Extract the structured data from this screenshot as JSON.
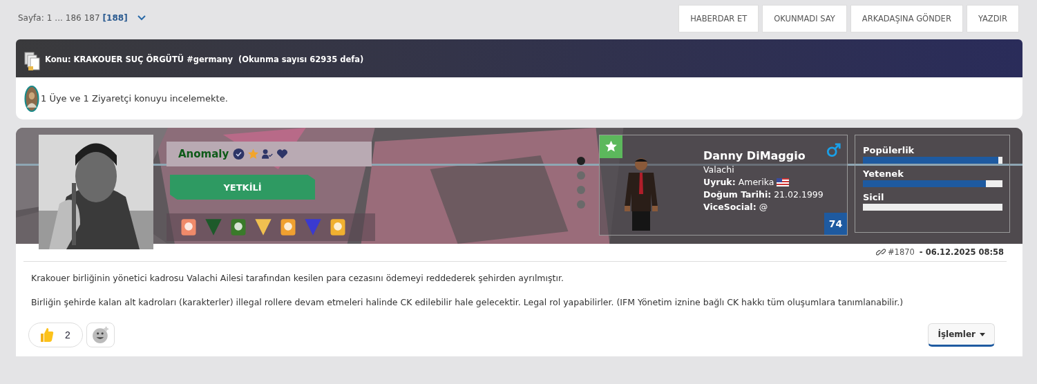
{
  "pagination": {
    "label": "Sayfa:",
    "pages": [
      {
        "text": "1",
        "selected": false
      },
      {
        "text": "...",
        "selected": false
      },
      {
        "text": "186",
        "selected": false
      },
      {
        "text": "187",
        "selected": false
      },
      {
        "text": "[188]",
        "selected": true
      }
    ]
  },
  "actions": [
    "HABERDAR ET",
    "OKUNMADI SAY",
    "ARKADAŞINA GÖNDER",
    "YAZDIR"
  ],
  "topic": {
    "title": "Konu: KRAKOUER SUÇ ÖRGÜTÜ #germany  (Okunma sayısı 62935 defa)"
  },
  "viewers": {
    "text": "1 Üye ve 1 Ziyaretçi konuyu incelemekte."
  },
  "post": {
    "author": {
      "username": "Anomaly",
      "rank": "YETKİLİ",
      "badges": [
        {
          "kind": "square"
        },
        {
          "kind": "shield"
        },
        {
          "kind": "square"
        },
        {
          "kind": "shield"
        },
        {
          "kind": "square"
        },
        {
          "kind": "shield"
        },
        {
          "kind": "square"
        }
      ]
    },
    "dots": [
      {
        "selected": true
      },
      {
        "selected": false
      },
      {
        "selected": false
      },
      {
        "selected": false
      }
    ],
    "character": {
      "name": "Danny DiMaggio",
      "family": "Valachi",
      "fields": [
        {
          "label": "Uyruk:",
          "value": "Amerika"
        },
        {
          "label": "Doğum Tarihi:",
          "value": "21.02.1999"
        },
        {
          "label": "ViceSocial:",
          "value": "@"
        }
      ],
      "level_badge": "74"
    },
    "stats": [
      {
        "label": "Popülerlik",
        "level": 0.97
      },
      {
        "label": "Yetenek",
        "level": 0.88
      },
      {
        "label": "Sicil",
        "level": 0
      }
    ],
    "number": "#1870",
    "date": " - 06.12.2025 08:58",
    "paragraphs": [
      "Krakouer birliğinin yönetici kadrosu Valachi Ailesi tarafından kesilen para cezasını ödemeyi reddederek şehirden ayrılmıştır.",
      "Birliğin şehirde kalan alt kadroları (karakterler) illegal rollere devam etmeleri halinde CK edilebilir hale gelecektir. Legal rol yapabilirler. (IFM Yönetim iznine bağlı CK hakkı tüm oluşumlara tanımlanabilir.)"
    ],
    "reactions": {
      "count": "2"
    },
    "menu": "İşlemler"
  }
}
